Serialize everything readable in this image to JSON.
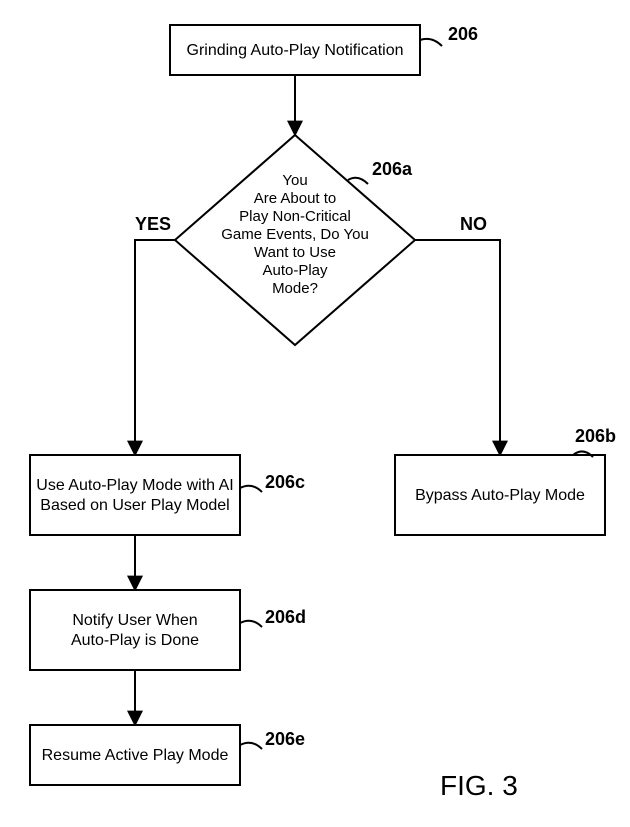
{
  "figure": "FIG. 3",
  "nodes": {
    "start": {
      "ref": "206",
      "text": "Grinding Auto-Play Notification"
    },
    "decision": {
      "ref": "206a",
      "lines": [
        "You",
        "Are About to",
        "Play Non-Critical",
        "Game Events, Do You",
        "Want to Use",
        "Auto-Play",
        "Mode?"
      ]
    },
    "yesPath": {
      "c": {
        "ref": "206c",
        "line1": "Use Auto-Play Mode with AI",
        "line2": "Based on User Play Model"
      },
      "d": {
        "ref": "206d",
        "line1": "Notify User When",
        "line2": "Auto-Play is Done"
      },
      "e": {
        "ref": "206e",
        "text": "Resume Active Play Mode"
      }
    },
    "noPath": {
      "b": {
        "ref": "206b",
        "text": "Bypass Auto-Play Mode"
      }
    }
  },
  "edges": {
    "yes": "YES",
    "no": "NO"
  }
}
